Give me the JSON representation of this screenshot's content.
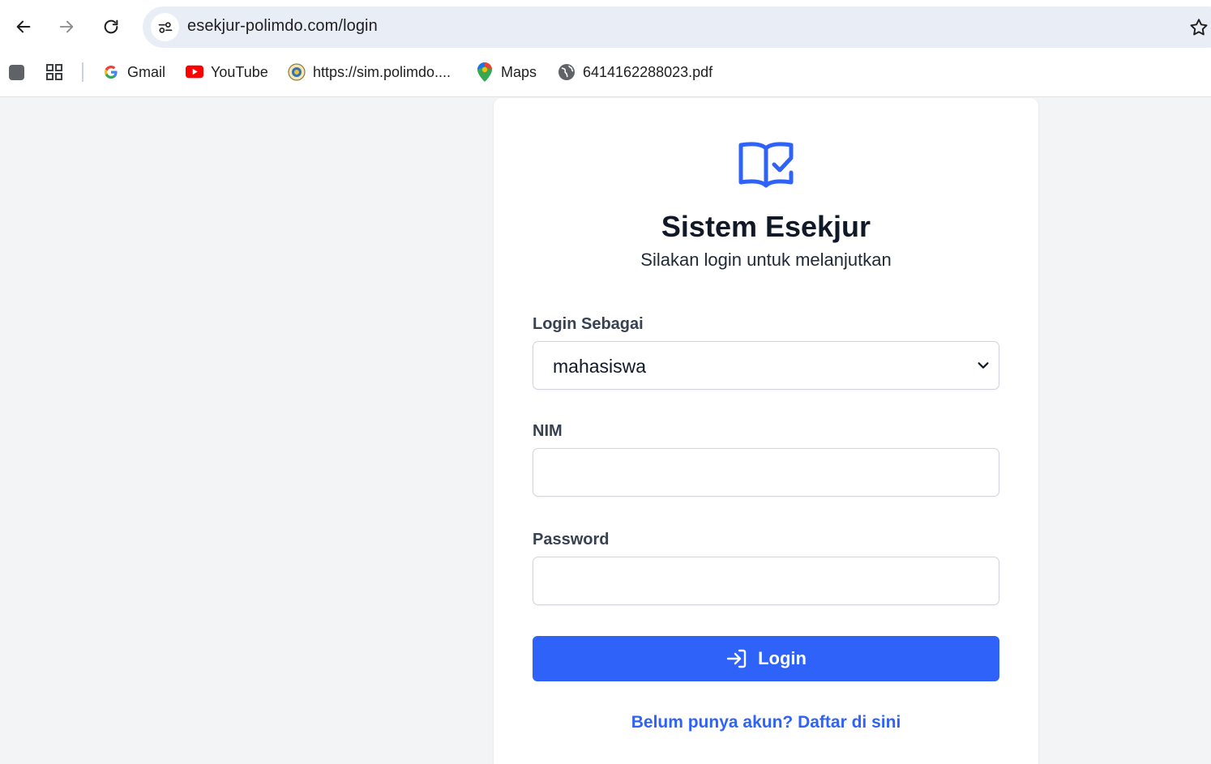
{
  "browser": {
    "url": "esekjur-polimdo.com/login",
    "bookmarks": [
      {
        "label": "Gmail",
        "icon": "gmail-icon"
      },
      {
        "label": "YouTube",
        "icon": "youtube-icon"
      },
      {
        "label": "https://sim.polimdo....",
        "icon": "polimdo-icon"
      },
      {
        "label": "Maps",
        "icon": "maps-icon"
      },
      {
        "label": "6414162288023.pdf",
        "icon": "globe-icon"
      }
    ]
  },
  "login": {
    "title": "Sistem Esekjur",
    "subtitle": "Silakan login untuk melanjutkan",
    "role_label": "Login Sebagai",
    "role_value": "mahasiswa",
    "nim_label": "NIM",
    "nim_value": "",
    "password_label": "Password",
    "password_value": "",
    "button_label": "Login",
    "register_link": "Belum punya akun? Daftar di sini"
  },
  "colors": {
    "primary": "#2f62f8",
    "page_background": "#f3f4f6"
  }
}
